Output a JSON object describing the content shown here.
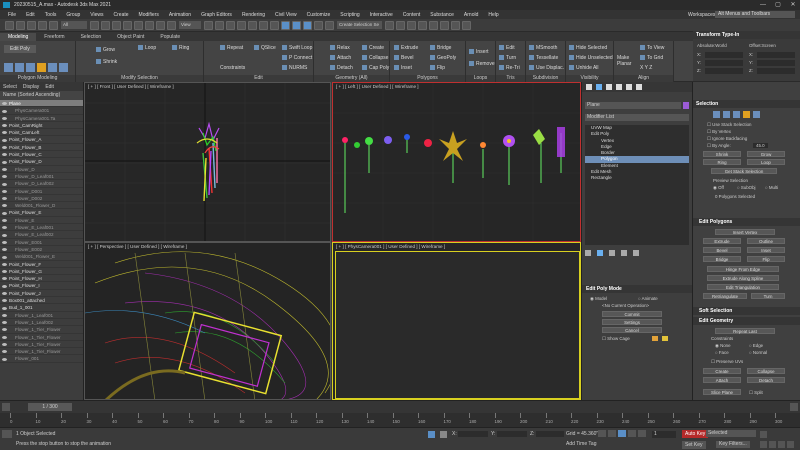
{
  "window": {
    "title": "20230515_A.max - Autodesk 3ds Max 2021",
    "controls": [
      "—",
      "▢",
      "✕"
    ]
  },
  "menu": [
    "File",
    "Edit",
    "Tools",
    "Group",
    "Views",
    "Create",
    "Modifiers",
    "Animation",
    "Graph Editors",
    "Rendering",
    "Civil View",
    "Customize",
    "Scripting",
    "Interactive",
    "Content",
    "Substance",
    "Arnold",
    "Help"
  ],
  "workspace": {
    "label": "Workspaces:",
    "value": "Alt Menus and Toolbars"
  },
  "toolbar": {
    "view_dropdown": "View",
    "selection_set": "Create Selection Se"
  },
  "ribbon_tabs": [
    "Modeling",
    "Freeform",
    "Selection",
    "Object Paint",
    "Populate"
  ],
  "ribbon": {
    "g1": {
      "label": "Polygon Modeling",
      "items": [
        "Edit Poly"
      ]
    },
    "g2": {
      "label": "Modify Selection",
      "items": [
        "Grow",
        "Shrink",
        "Loop",
        "Ring"
      ]
    },
    "g3": {
      "label": "Edit",
      "items": [
        "Repeat",
        "QSlice",
        "Swift Loop",
        "Constraints",
        "P Connect",
        "NURMS"
      ]
    },
    "g4": {
      "label": "Geometry (All)",
      "items": [
        "Relax",
        "Create",
        "Attach",
        "Collapse",
        "Detach",
        "Cap Poly"
      ]
    },
    "g5": {
      "label": "Polygons",
      "items": [
        "Extrude",
        "Bridge",
        "Bevel",
        "GeoPoly",
        "Inset",
        "Flip"
      ]
    },
    "g6": {
      "label": "Loops",
      "items": [
        "Insert",
        "Remove"
      ]
    },
    "g7": {
      "label": "Tris",
      "items": [
        "Edit",
        "Turn",
        "Re-Tri"
      ]
    },
    "g8": {
      "label": "Subdivision",
      "items": [
        "MSmooth",
        "Tessellate",
        "Use Displac."
      ]
    },
    "g9": {
      "label": "Visibility",
      "items": [
        "Hide Selected",
        "Hide Unselected",
        "Unhide All"
      ]
    },
    "g10": {
      "label": "Align",
      "items": [
        "Make Planar",
        "To View",
        "To Grid",
        "X Y Z"
      ]
    }
  },
  "scene": {
    "tabs": [
      "Select",
      "Display",
      "Edit"
    ],
    "header": "Name (Sorted Ascending)",
    "rows": [
      {
        "name": "Plane",
        "sel": true,
        "sub": false
      },
      {
        "name": "PhysCamera001",
        "sel": false,
        "sub": true
      },
      {
        "name": "PhysCamera001.Ta",
        "sel": false,
        "sub": true
      },
      {
        "name": "Point_CamRight",
        "sel": false,
        "sub": false
      },
      {
        "name": "Point_CamLeft",
        "sel": false,
        "sub": false
      },
      {
        "name": "Point_Flower_A",
        "sel": false,
        "sub": false
      },
      {
        "name": "Point_Flower_B",
        "sel": false,
        "sub": false
      },
      {
        "name": "Point_Flower_C",
        "sel": false,
        "sub": false
      },
      {
        "name": "Point_Flower_D",
        "sel": false,
        "sub": false
      },
      {
        "name": "Flower_D",
        "sel": false,
        "sub": true
      },
      {
        "name": "Flower_D_Leaf001",
        "sel": false,
        "sub": true
      },
      {
        "name": "Flower_D_Leaf002",
        "sel": false,
        "sub": true
      },
      {
        "name": "Flower_D001",
        "sel": false,
        "sub": true
      },
      {
        "name": "Flower_D002",
        "sel": false,
        "sub": true
      },
      {
        "name": "Weld001_Flower_D",
        "sel": false,
        "sub": true
      },
      {
        "name": "Point_Flower_E",
        "sel": false,
        "sub": false
      },
      {
        "name": "Flower_E",
        "sel": false,
        "sub": true
      },
      {
        "name": "Flower_E_Leaf001",
        "sel": false,
        "sub": true
      },
      {
        "name": "Flower_E_Leaf002",
        "sel": false,
        "sub": true
      },
      {
        "name": "Flower_E001",
        "sel": false,
        "sub": true
      },
      {
        "name": "Flower_E002",
        "sel": false,
        "sub": true
      },
      {
        "name": "Weld001_Flower_E",
        "sel": false,
        "sub": true
      },
      {
        "name": "Point_Flower_F",
        "sel": false,
        "sub": false
      },
      {
        "name": "Point_Flower_G",
        "sel": false,
        "sub": false
      },
      {
        "name": "Point_Flower_H",
        "sel": false,
        "sub": false
      },
      {
        "name": "Point_Flower_I",
        "sel": false,
        "sub": false
      },
      {
        "name": "Point_Flower_J",
        "sel": false,
        "sub": false
      },
      {
        "name": "Box001_attached",
        "sel": false,
        "sub": false
      },
      {
        "name": "Bud_1_001",
        "sel": false,
        "sub": false
      },
      {
        "name": "Flower_1_Leaf001",
        "sel": false,
        "sub": true
      },
      {
        "name": "Flower_1_Leaf002",
        "sel": false,
        "sub": true
      },
      {
        "name": "Flower_1_Tier_Flower",
        "sel": false,
        "sub": true
      },
      {
        "name": "Flower_1_Tier_Flower",
        "sel": false,
        "sub": true
      },
      {
        "name": "Flower_1_Tier_Flower",
        "sel": false,
        "sub": true
      },
      {
        "name": "Flower_1_Tier_Flower",
        "sel": false,
        "sub": true
      },
      {
        "name": "Flower_001",
        "sel": false,
        "sub": true
      }
    ]
  },
  "viewports": {
    "front": "[ + ] [ Front ] [ User Defined ] [ Wireframe ]",
    "left": "[ + ] [ Left ] [ User Defined ] [ Wireframe ]",
    "persp": "[ + ] [ Perspective ] [ User Defined ] [ Wireframe ]",
    "camera": "[ + ] [ PhysCamera001 ] [ User Defined ] [ Wireframe ]"
  },
  "cmd": {
    "object_name": "Plane",
    "modifier_list": "Modifier List",
    "stack": [
      {
        "label": "UVW Map",
        "level": 0
      },
      {
        "label": "Edit Poly",
        "level": 0
      },
      {
        "label": "Vertex",
        "level": 1
      },
      {
        "label": "Edge",
        "level": 1
      },
      {
        "label": "Border",
        "level": 1
      },
      {
        "label": "Polygon",
        "level": 1,
        "sel": true
      },
      {
        "label": "Element",
        "level": 1
      },
      {
        "label": "Edit Mesh",
        "level": 0
      },
      {
        "label": "Rectangle",
        "level": 0
      }
    ],
    "editpoly_mode": {
      "title": "Edit Poly Mode",
      "model": "Model",
      "animate": "Animate",
      "current_op": "<No Current Operation>",
      "commit": "Commit",
      "settings": "Settings",
      "cancel": "Cancel",
      "show_cage": "Show Cage"
    }
  },
  "right": {
    "transform": {
      "title": "Transform Type-In",
      "absolute": "Absolute:World",
      "offset": "Offset:Screen",
      "axes": [
        "X:",
        "Y:",
        "Z:"
      ]
    },
    "selection": {
      "title": "Selection",
      "use_stack": "Use Stack Selection",
      "by_vertex": "By Vertex",
      "ignore_back": "Ignore Backfacing",
      "by_angle": "By Angle:",
      "angle_val": "45.0",
      "shrink": "Shrink",
      "grow": "Grow",
      "ring": "Ring",
      "loop": "Loop",
      "get_stack": "Get Stack Selection",
      "preview": "Preview Selection",
      "off": "Off",
      "subobj": "SubObj",
      "multi": "Multi",
      "count": "0 Polygons Selected"
    },
    "edit_polygons": {
      "title": "Edit Polygons",
      "insert_vertex": "Insert Vertex",
      "extrude": "Extrude",
      "outline": "Outline",
      "bevel": "Bevel",
      "inset": "Inset",
      "bridge": "Bridge",
      "flip": "Flip",
      "hinge": "Hinge From Edge",
      "extrude_spline": "Extrude Along Spline",
      "edit_tri": "Edit Triangulation",
      "retriangulate": "Retriangulate",
      "turn": "Turn"
    },
    "soft_selection": {
      "title": "Soft Selection"
    },
    "edit_geometry": {
      "title": "Edit Geometry",
      "repeat_last": "Repeat Last",
      "constraints": "Constraints",
      "none": "None",
      "edge": "Edge",
      "face": "Face",
      "normal": "Normal",
      "preserve_uvs": "Preserve UVs",
      "create": "Create",
      "collapse": "Collapse",
      "attach": "Attach",
      "detach": "Detach",
      "slice_plane": "Slice Plane",
      "split": "Split"
    }
  },
  "timeline": {
    "frame": "1 / 300",
    "ticks": [
      "0",
      "10",
      "20",
      "30",
      "40",
      "50",
      "60",
      "70",
      "80",
      "90",
      "100",
      "110",
      "120",
      "130",
      "140",
      "150",
      "160",
      "170",
      "180",
      "190",
      "200",
      "210",
      "220",
      "230",
      "240",
      "250",
      "260",
      "270",
      "280",
      "290",
      "300"
    ]
  },
  "status": {
    "selected": "1 Object Selected",
    "prompt": "Press the stop button to stop the animation",
    "x": "X:",
    "y": "Y:",
    "z": "Z:",
    "grid": "Grid = 45.360\"",
    "add_time_tag": "Add Time Tag",
    "auto_key": "Auto Key",
    "set_key": "Set Key",
    "selected_dd": "Selected",
    "key_filters": "Key Filters...",
    "frame_val": "1"
  }
}
